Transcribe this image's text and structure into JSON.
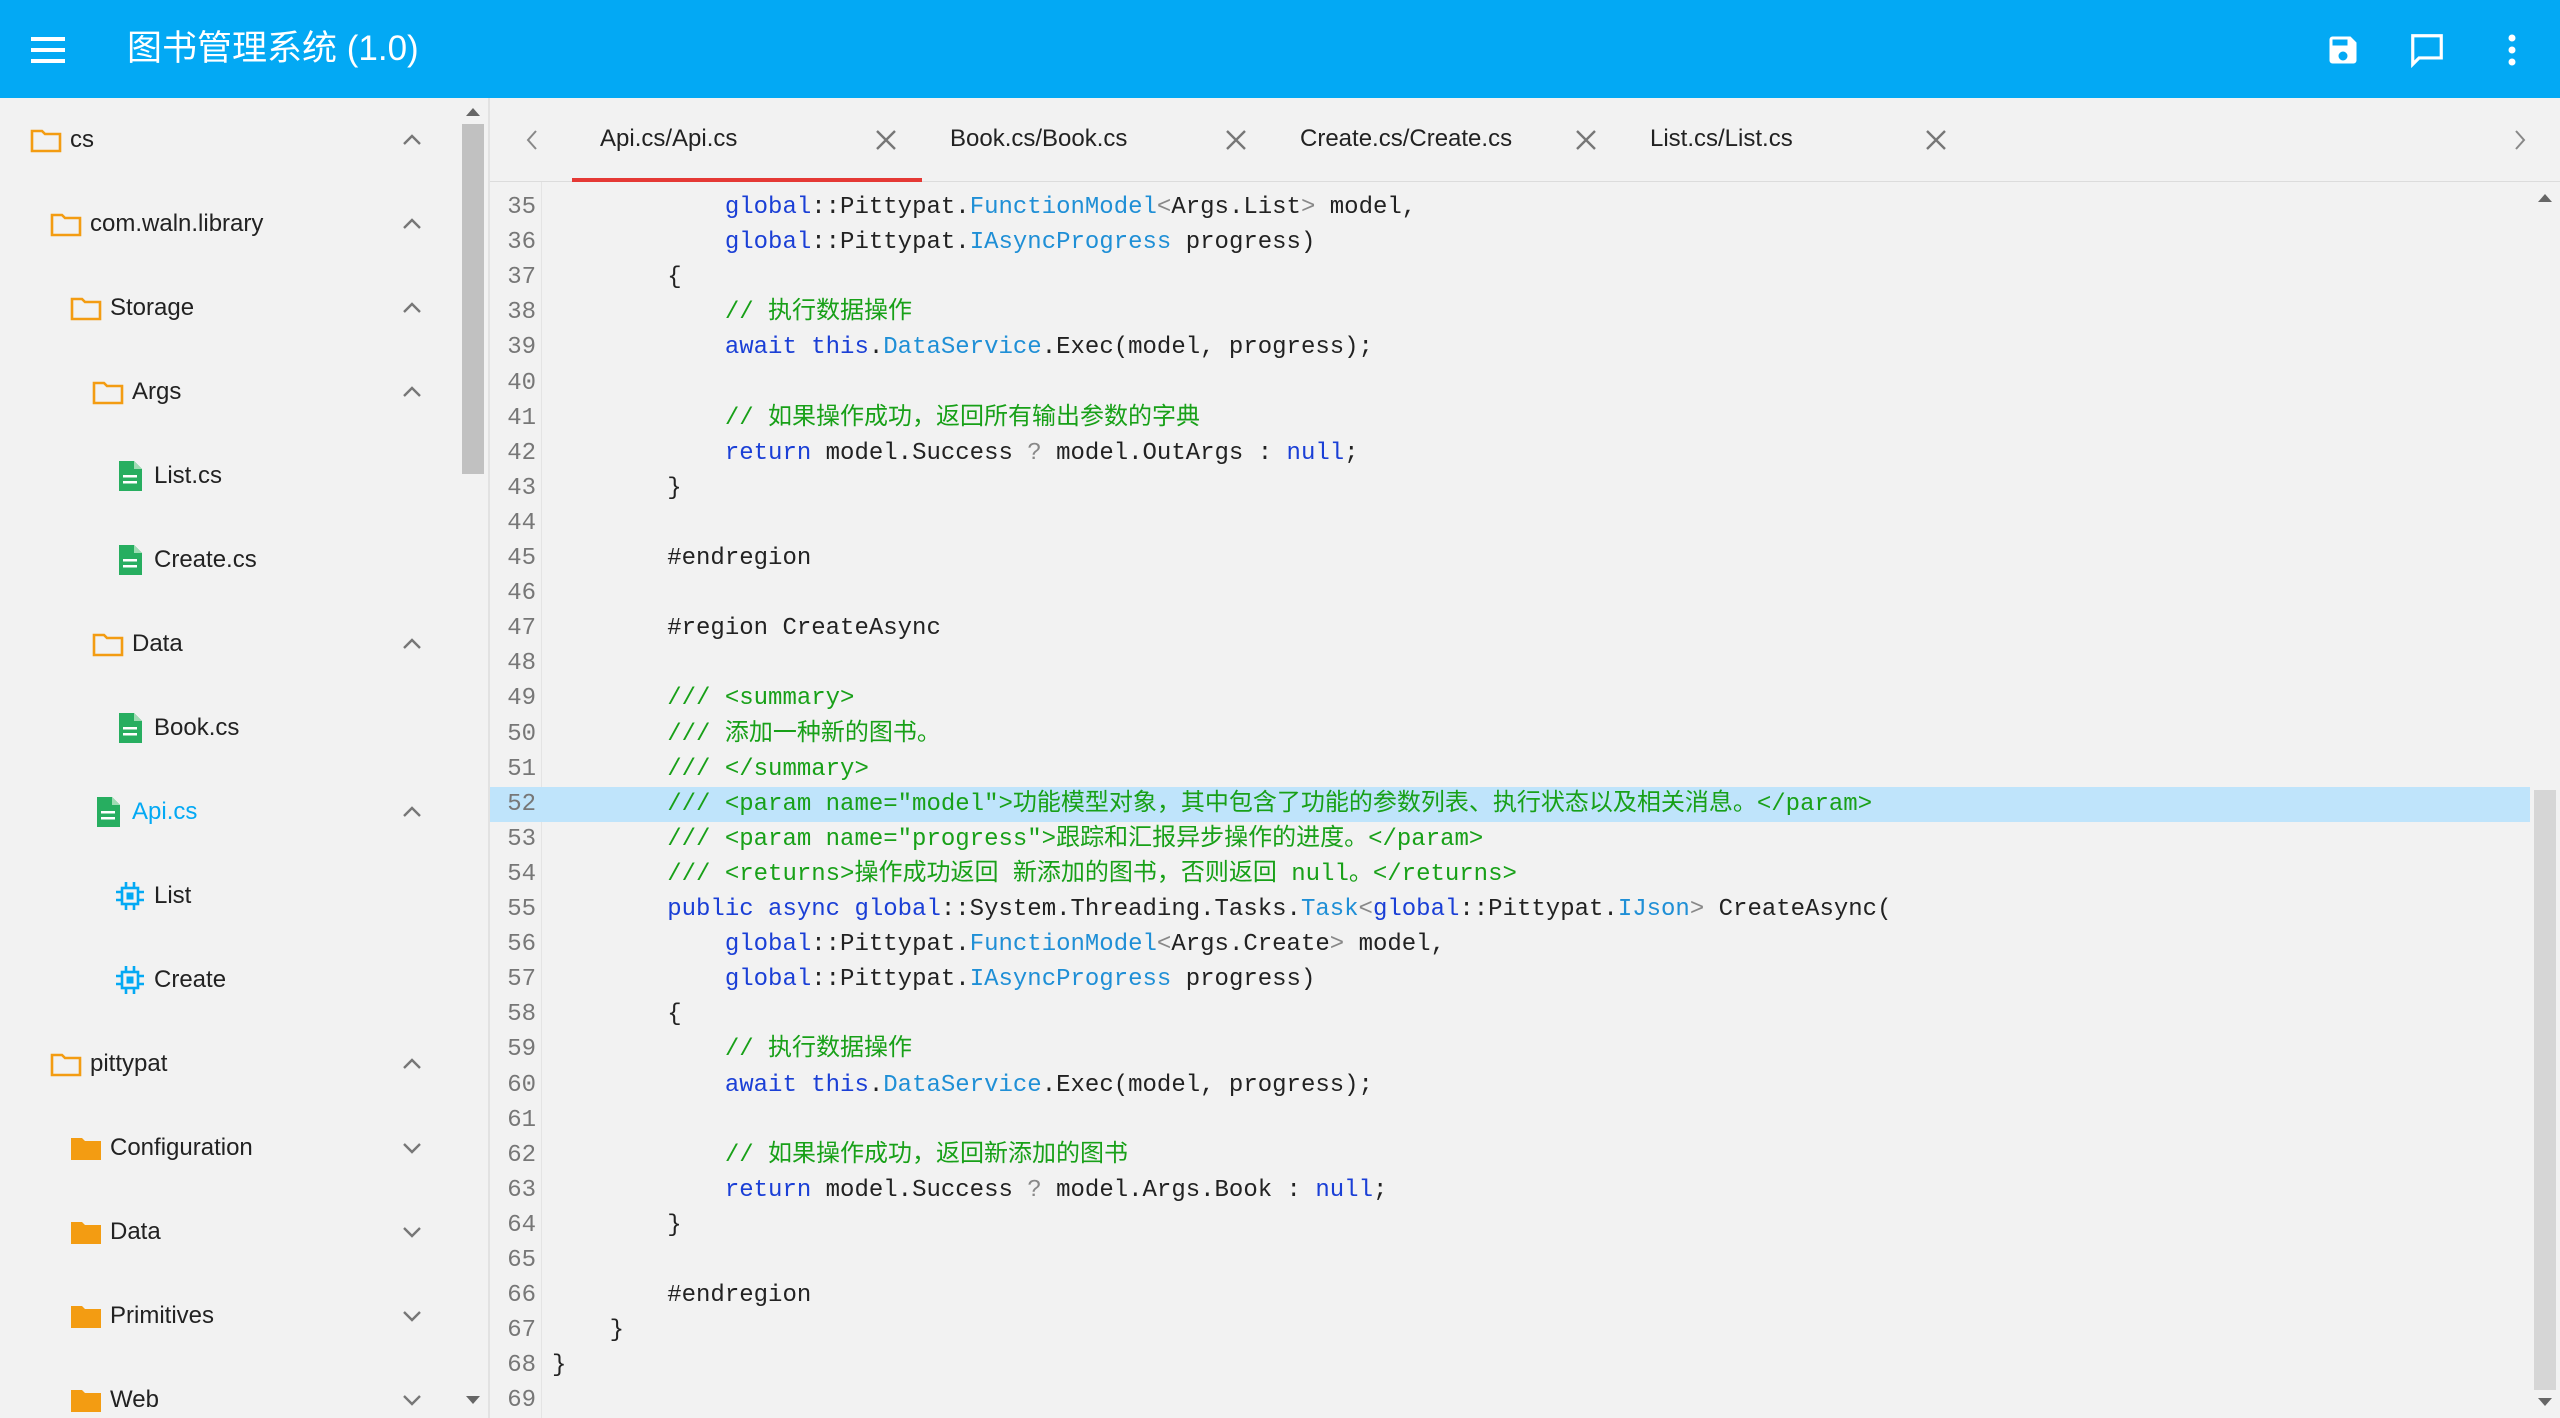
{
  "appbar": {
    "title": "图书管理系统 (1.0)",
    "menu_icon": "menu-icon",
    "actions": [
      {
        "name": "save-button",
        "icon": "save-icon"
      },
      {
        "name": "comment-button",
        "icon": "comment-icon"
      },
      {
        "name": "more-button",
        "icon": "more-vert-icon"
      }
    ]
  },
  "sidebar": {
    "items": [
      {
        "label": "cs",
        "icon": "folder-outline-icon",
        "depth": 0,
        "chevron": "up"
      },
      {
        "label": "com.waln.library",
        "icon": "folder-outline-icon",
        "depth": 1,
        "chevron": "up"
      },
      {
        "label": "Storage",
        "icon": "folder-outline-icon",
        "depth": 2,
        "chevron": "up"
      },
      {
        "label": "Args",
        "icon": "folder-outline-icon",
        "depth": 3,
        "chevron": "up"
      },
      {
        "label": "List.cs",
        "icon": "file-icon",
        "depth": 4,
        "chevron": ""
      },
      {
        "label": "Create.cs",
        "icon": "file-icon",
        "depth": 4,
        "chevron": ""
      },
      {
        "label": "Data",
        "icon": "folder-outline-icon",
        "depth": 3,
        "chevron": "up"
      },
      {
        "label": "Book.cs",
        "icon": "file-icon",
        "depth": 4,
        "chevron": ""
      },
      {
        "label": "Api.cs",
        "icon": "file-icon",
        "depth": 3,
        "chevron": "up",
        "active": true
      },
      {
        "label": "List",
        "icon": "method-icon",
        "depth": 4,
        "chevron": ""
      },
      {
        "label": "Create",
        "icon": "method-icon",
        "depth": 4,
        "chevron": ""
      },
      {
        "label": "pittypat",
        "icon": "folder-outline-icon",
        "depth": 1,
        "chevron": "up"
      },
      {
        "label": "Configuration",
        "icon": "folder-filled-icon",
        "depth": 2,
        "chevron": "down"
      },
      {
        "label": "Data",
        "icon": "folder-filled-icon",
        "depth": 2,
        "chevron": "down"
      },
      {
        "label": "Primitives",
        "icon": "folder-filled-icon",
        "depth": 2,
        "chevron": "down"
      },
      {
        "label": "Web",
        "icon": "folder-filled-icon",
        "depth": 2,
        "chevron": "down"
      }
    ]
  },
  "tabs": [
    {
      "label": "Api.cs/Api.cs",
      "active": true
    },
    {
      "label": "Book.cs/Book.cs",
      "active": false
    },
    {
      "label": "Create.cs/Create.cs",
      "active": false
    },
    {
      "label": "List.cs/List.cs",
      "active": false
    }
  ],
  "editor": {
    "highlighted_line": 52,
    "lines": [
      {
        "n": "35",
        "code": [
          [
            "p",
            "            "
          ],
          [
            "kw",
            "global"
          ],
          [
            "p",
            "::Pittypat."
          ],
          [
            "ty",
            "FunctionModel"
          ],
          [
            "pu",
            "<"
          ],
          [
            "p",
            "Args.List"
          ],
          [
            "pu",
            ">"
          ],
          [
            "p",
            " model,"
          ]
        ]
      },
      {
        "n": "36",
        "code": [
          [
            "p",
            "            "
          ],
          [
            "kw",
            "global"
          ],
          [
            "p",
            "::Pittypat."
          ],
          [
            "ty",
            "IAsyncProgress"
          ],
          [
            "p",
            " progress)"
          ]
        ]
      },
      {
        "n": "37",
        "code": [
          [
            "p",
            "        {"
          ]
        ]
      },
      {
        "n": "38",
        "code": [
          [
            "p",
            "            "
          ],
          [
            "cm",
            "// 执行数据操作"
          ]
        ]
      },
      {
        "n": "39",
        "code": [
          [
            "p",
            "            "
          ],
          [
            "kw",
            "await this"
          ],
          [
            "p",
            "."
          ],
          [
            "ty",
            "DataService"
          ],
          [
            "p",
            ".Exec(model, progress);"
          ]
        ]
      },
      {
        "n": "40",
        "code": []
      },
      {
        "n": "41",
        "code": [
          [
            "p",
            "            "
          ],
          [
            "cm",
            "// 如果操作成功，返回所有输出参数的字典"
          ]
        ]
      },
      {
        "n": "42",
        "code": [
          [
            "p",
            "            "
          ],
          [
            "kw",
            "return"
          ],
          [
            "p",
            " model.Success "
          ],
          [
            "pu",
            "?"
          ],
          [
            "p",
            " model.OutArgs : "
          ],
          [
            "kw",
            "null"
          ],
          [
            "p",
            ";"
          ]
        ]
      },
      {
        "n": "43",
        "code": [
          [
            "p",
            "        }"
          ]
        ]
      },
      {
        "n": "44",
        "code": []
      },
      {
        "n": "45",
        "code": [
          [
            "p",
            "        #endregion"
          ]
        ]
      },
      {
        "n": "46",
        "code": []
      },
      {
        "n": "47",
        "code": [
          [
            "p",
            "        #region CreateAsync"
          ]
        ]
      },
      {
        "n": "48",
        "code": []
      },
      {
        "n": "49",
        "code": [
          [
            "p",
            "        "
          ],
          [
            "cm",
            "/// <summary>"
          ]
        ]
      },
      {
        "n": "50",
        "code": [
          [
            "p",
            "        "
          ],
          [
            "cm",
            "/// 添加一种新的图书。"
          ]
        ]
      },
      {
        "n": "51",
        "code": [
          [
            "p",
            "        "
          ],
          [
            "cm",
            "/// </summary>"
          ]
        ]
      },
      {
        "n": "52",
        "code": [
          [
            "p",
            "        "
          ],
          [
            "cm",
            "/// <param name=\"model\">功能模型对象，其中包含了功能的参数列表、执行状态以及相关消息。</param>"
          ]
        ]
      },
      {
        "n": "53",
        "code": [
          [
            "p",
            "        "
          ],
          [
            "cm",
            "/// <param name=\"progress\">跟踪和汇报异步操作的进度。</param>"
          ]
        ]
      },
      {
        "n": "54",
        "code": [
          [
            "p",
            "        "
          ],
          [
            "cm",
            "/// <returns>操作成功返回 新添加的图书，否则返回 null。</returns>"
          ]
        ]
      },
      {
        "n": "55",
        "code": [
          [
            "p",
            "        "
          ],
          [
            "kw",
            "public async global"
          ],
          [
            "p",
            "::System.Threading.Tasks."
          ],
          [
            "ty",
            "Task"
          ],
          [
            "pu",
            "<"
          ],
          [
            "kw",
            "global"
          ],
          [
            "p",
            "::Pittypat."
          ],
          [
            "ty",
            "IJson"
          ],
          [
            "pu",
            ">"
          ],
          [
            "p",
            " CreateAsync("
          ]
        ]
      },
      {
        "n": "56",
        "code": [
          [
            "p",
            "            "
          ],
          [
            "kw",
            "global"
          ],
          [
            "p",
            "::Pittypat."
          ],
          [
            "ty",
            "FunctionModel"
          ],
          [
            "pu",
            "<"
          ],
          [
            "p",
            "Args.Create"
          ],
          [
            "pu",
            ">"
          ],
          [
            "p",
            " model,"
          ]
        ]
      },
      {
        "n": "57",
        "code": [
          [
            "p",
            "            "
          ],
          [
            "kw",
            "global"
          ],
          [
            "p",
            "::Pittypat."
          ],
          [
            "ty",
            "IAsyncProgress"
          ],
          [
            "p",
            " progress)"
          ]
        ]
      },
      {
        "n": "58",
        "code": [
          [
            "p",
            "        {"
          ]
        ]
      },
      {
        "n": "59",
        "code": [
          [
            "p",
            "            "
          ],
          [
            "cm",
            "// 执行数据操作"
          ]
        ]
      },
      {
        "n": "60",
        "code": [
          [
            "p",
            "            "
          ],
          [
            "kw",
            "await this"
          ],
          [
            "p",
            "."
          ],
          [
            "ty",
            "DataService"
          ],
          [
            "p",
            ".Exec(model, progress);"
          ]
        ]
      },
      {
        "n": "61",
        "code": []
      },
      {
        "n": "62",
        "code": [
          [
            "p",
            "            "
          ],
          [
            "cm",
            "// 如果操作成功，返回新添加的图书"
          ]
        ]
      },
      {
        "n": "63",
        "code": [
          [
            "p",
            "            "
          ],
          [
            "kw",
            "return"
          ],
          [
            "p",
            " model.Success "
          ],
          [
            "pu",
            "?"
          ],
          [
            "p",
            " model.Args.Book : "
          ],
          [
            "kw",
            "null"
          ],
          [
            "p",
            ";"
          ]
        ]
      },
      {
        "n": "64",
        "code": [
          [
            "p",
            "        }"
          ]
        ]
      },
      {
        "n": "65",
        "code": []
      },
      {
        "n": "66",
        "code": [
          [
            "p",
            "        #endregion"
          ]
        ]
      },
      {
        "n": "67",
        "code": [
          [
            "p",
            "    }"
          ]
        ]
      },
      {
        "n": "68",
        "code": [
          [
            "p",
            "}"
          ]
        ]
      },
      {
        "n": "69",
        "code": []
      }
    ]
  },
  "colors": {
    "appbar": "#03a9f4",
    "active_tab_underline": "#e53935",
    "folder": "#f39c12",
    "file": "#27ae60",
    "method": "#03a9f4",
    "highlight": "#bfe4fb"
  }
}
